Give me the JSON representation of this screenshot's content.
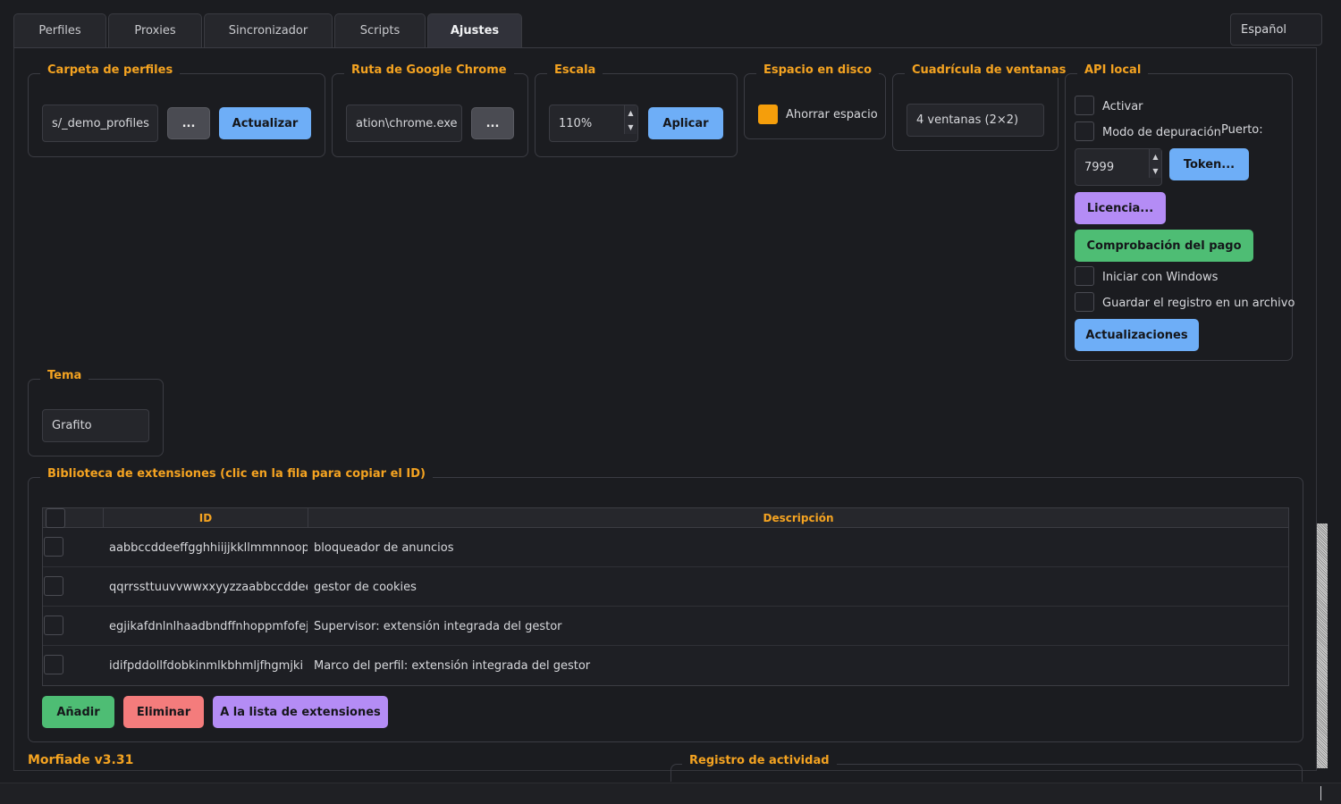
{
  "tabs": [
    {
      "label": "Perfiles"
    },
    {
      "label": "Proxies"
    },
    {
      "label": "Sincronizador"
    },
    {
      "label": "Scripts"
    },
    {
      "label": "Ajustes"
    }
  ],
  "language": {
    "selected": "Español"
  },
  "profiles_folder": {
    "title": "Carpeta de perfiles",
    "value": "s/_demo_profiles",
    "browse_label": "...",
    "refresh_label": "Actualizar"
  },
  "chrome_path": {
    "title": "Ruta de Google Chrome",
    "value": "ation\\chrome.exe",
    "browse_label": "..."
  },
  "scale": {
    "title": "Escala",
    "value": "110%",
    "apply_label": "Aplicar"
  },
  "disk": {
    "title": "Espacio en disco",
    "save_label": "Ahorrar espacio",
    "checked_color": "#f59e0b"
  },
  "grid": {
    "title": "Cuadrícula de ventanas",
    "value": "4 ventanas (2×2)"
  },
  "api": {
    "title": "API local",
    "enable_label": "Activar",
    "debug_label": "Modo de depuración",
    "port_label": "Puerto:",
    "port_value": "7999",
    "token_label": "Token...",
    "license_label": "Licencia...",
    "payment_label": "Comprobación del pago",
    "startup_label": "Iniciar con Windows",
    "log_file_label": "Guardar el registro en un archivo",
    "updates_label": "Actualizaciones"
  },
  "theme": {
    "title": "Tema",
    "value": "Grafito"
  },
  "extensions": {
    "title": "Biblioteca de extensiones (clic en la fila para copiar el ID)",
    "columns": {
      "id": "ID",
      "description": "Descripción"
    },
    "rows": [
      {
        "id": "aabbccddeeffgghhiijjkkllmmnnoopp",
        "description": "bloqueador de anuncios"
      },
      {
        "id": "qqrrssttuuvvwwxxyyzzaabbccddeeff",
        "description": "gestor de cookies"
      },
      {
        "id": "egjikafdnlnlhaadbndffnhoppmfofej",
        "description": "Supervisor: extensión integrada del gestor"
      },
      {
        "id": "idifpddollfdobkinmlkbhmljfhgmjki",
        "description": "Marco del perfil: extensión integrada del gestor"
      }
    ],
    "add_label": "Añadir",
    "delete_label": "Eliminar",
    "to_list_label": "A la lista de extensiones"
  },
  "footer": {
    "version": "Morfiade v3.31",
    "activity_log_title": "Registro de actividad"
  }
}
